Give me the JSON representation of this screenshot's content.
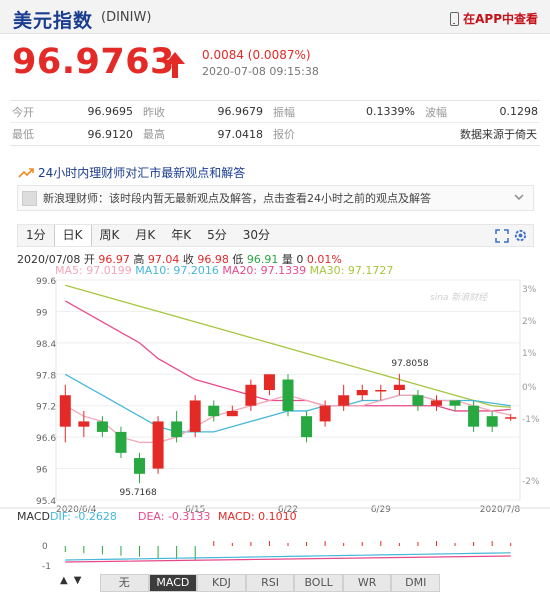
{
  "header": {
    "title": "美元指数",
    "code": "(DINIW)",
    "app_link": "在APP中查看"
  },
  "quote": {
    "price": "96.9763",
    "change": "0.0084 (0.0087%)",
    "time": "2020-07-08 09:15:38"
  },
  "stats": {
    "open_label": "今开",
    "open": "96.9695",
    "prev_label": "昨收",
    "prev": "96.9679",
    "amp_label": "振幅",
    "amp": "0.1339%",
    "wave_label": "波幅",
    "wave": "0.1298",
    "low_label": "最低",
    "low": "96.9120",
    "high_label": "最高",
    "high": "97.0418",
    "quote_label": "报价",
    "source": "数据来源于倚天"
  },
  "news": {
    "heading": "24小时内理财师对汇市最新观点和解答",
    "item": "新浪理财师：该时段内暂无最新观点及解答，点击查看24小时之前的观点及解答"
  },
  "tabs": [
    "1分",
    "日K",
    "周K",
    "月K",
    "年K",
    "5分",
    "30分"
  ],
  "active_tab": "日K",
  "legend": {
    "date": "2020/07/08",
    "open_label": "开",
    "open": "96.97",
    "high_label": "高",
    "high": "97.04",
    "close_label": "收",
    "close": "96.98",
    "low_label": "低",
    "low": "96.91",
    "vol_label": "量",
    "vol": "0",
    "pct": "0.01%",
    "ma5": "MA5: 97.0199",
    "ma10": "MA10: 97.2016",
    "ma20": "MA20: 97.1339",
    "ma30": "MA30: 97.1727"
  },
  "macd": {
    "label": "MACD",
    "dif": "DIF: -0.2628",
    "dea": "DEA: -0.3133",
    "macd": "MACD: 0.1010",
    "y_labels": [
      "0",
      "-1"
    ]
  },
  "bottom_tabs": [
    "无",
    "MACD",
    "KDJ",
    "RSI",
    "BOLL",
    "WR",
    "DMI"
  ],
  "active_bottom_tab": "MACD",
  "colors": {
    "up": "#e32a26",
    "down": "#27a840",
    "ma5": "#f4a6b8",
    "ma10": "#45b8d8",
    "ma20": "#e9498a",
    "ma30": "#a6c63e"
  },
  "chart_data": {
    "type": "candlestick",
    "y_ticks": [
      "99.6",
      "99",
      "98.4",
      "97.8",
      "97.2",
      "96.6",
      "96",
      "95.4"
    ],
    "pct_ticks": [
      "3%",
      "2%",
      "1%",
      "0%",
      "-1%",
      "-2%"
    ],
    "x_labels": [
      "2020/6/4",
      "6/15",
      "6/22",
      "6/29",
      "2020/7/8"
    ],
    "annotations": {
      "max": "97.8058",
      "min": "95.7168"
    },
    "ylim": [
      95.4,
      99.6
    ],
    "candles": [
      {
        "o": 96.8,
        "c": 97.4,
        "h": 97.6,
        "l": 96.5
      },
      {
        "o": 96.8,
        "c": 96.9,
        "h": 97.1,
        "l": 96.6
      },
      {
        "o": 96.9,
        "c": 96.7,
        "h": 97.0,
        "l": 96.6
      },
      {
        "o": 96.7,
        "c": 96.3,
        "h": 96.8,
        "l": 96.2
      },
      {
        "o": 96.2,
        "c": 95.9,
        "h": 96.3,
        "l": 95.72
      },
      {
        "o": 96.0,
        "c": 96.9,
        "h": 97.0,
        "l": 95.9
      },
      {
        "o": 96.9,
        "c": 96.6,
        "h": 97.1,
        "l": 96.5
      },
      {
        "o": 96.7,
        "c": 97.3,
        "h": 97.4,
        "l": 96.6
      },
      {
        "o": 97.2,
        "c": 97.0,
        "h": 97.3,
        "l": 96.9
      },
      {
        "o": 97.0,
        "c": 97.1,
        "h": 97.2,
        "l": 97.0
      },
      {
        "o": 97.2,
        "c": 97.6,
        "h": 97.7,
        "l": 97.1
      },
      {
        "o": 97.5,
        "c": 97.8,
        "h": 97.8,
        "l": 97.4
      },
      {
        "o": 97.7,
        "c": 97.1,
        "h": 97.8,
        "l": 97.0
      },
      {
        "o": 97.0,
        "c": 96.6,
        "h": 97.1,
        "l": 96.5
      },
      {
        "o": 96.9,
        "c": 97.2,
        "h": 97.3,
        "l": 96.8
      },
      {
        "o": 97.2,
        "c": 97.4,
        "h": 97.6,
        "l": 97.1
      },
      {
        "o": 97.4,
        "c": 97.5,
        "h": 97.6,
        "l": 97.3
      },
      {
        "o": 97.5,
        "c": 97.5,
        "h": 97.6,
        "l": 97.3
      },
      {
        "o": 97.5,
        "c": 97.6,
        "h": 97.81,
        "l": 97.4
      },
      {
        "o": 97.4,
        "c": 97.2,
        "h": 97.5,
        "l": 97.1
      },
      {
        "o": 97.2,
        "c": 97.3,
        "h": 97.4,
        "l": 97.1
      },
      {
        "o": 97.3,
        "c": 97.2,
        "h": 97.3,
        "l": 97.1
      },
      {
        "o": 97.2,
        "c": 96.8,
        "h": 97.3,
        "l": 96.7
      },
      {
        "o": 97.0,
        "c": 96.8,
        "h": 97.1,
        "l": 96.7
      },
      {
        "o": 96.97,
        "c": 96.98,
        "h": 97.04,
        "l": 96.91
      }
    ],
    "ma5": [
      97.2,
      97.0,
      96.9,
      96.6,
      96.5,
      96.5,
      96.6,
      96.8,
      97.0,
      97.1,
      97.2,
      97.3,
      97.4,
      97.3,
      97.2,
      97.2,
      97.2,
      97.3,
      97.4,
      97.4,
      97.3,
      97.3,
      97.2,
      97.1,
      97.02
    ],
    "ma10": [
      97.8,
      97.6,
      97.4,
      97.2,
      97.0,
      96.8,
      96.7,
      96.7,
      96.7,
      96.8,
      96.9,
      97.0,
      97.1,
      97.1,
      97.2,
      97.2,
      97.3,
      97.3,
      97.4,
      97.4,
      97.3,
      97.3,
      97.3,
      97.25,
      97.2
    ],
    "ma20": [
      99.2,
      99.0,
      98.8,
      98.6,
      98.4,
      98.1,
      97.9,
      97.7,
      97.6,
      97.5,
      97.4,
      97.3,
      97.3,
      97.3,
      97.2,
      97.2,
      97.2,
      97.2,
      97.2,
      97.2,
      97.2,
      97.1,
      97.1,
      97.1,
      97.13
    ],
    "ma30": [
      99.5,
      99.4,
      99.3,
      99.2,
      99.1,
      99.0,
      98.9,
      98.8,
      98.7,
      98.6,
      98.5,
      98.4,
      98.3,
      98.2,
      98.1,
      98.0,
      97.9,
      97.8,
      97.7,
      97.6,
      97.5,
      97.4,
      97.3,
      97.2,
      97.17
    ]
  }
}
